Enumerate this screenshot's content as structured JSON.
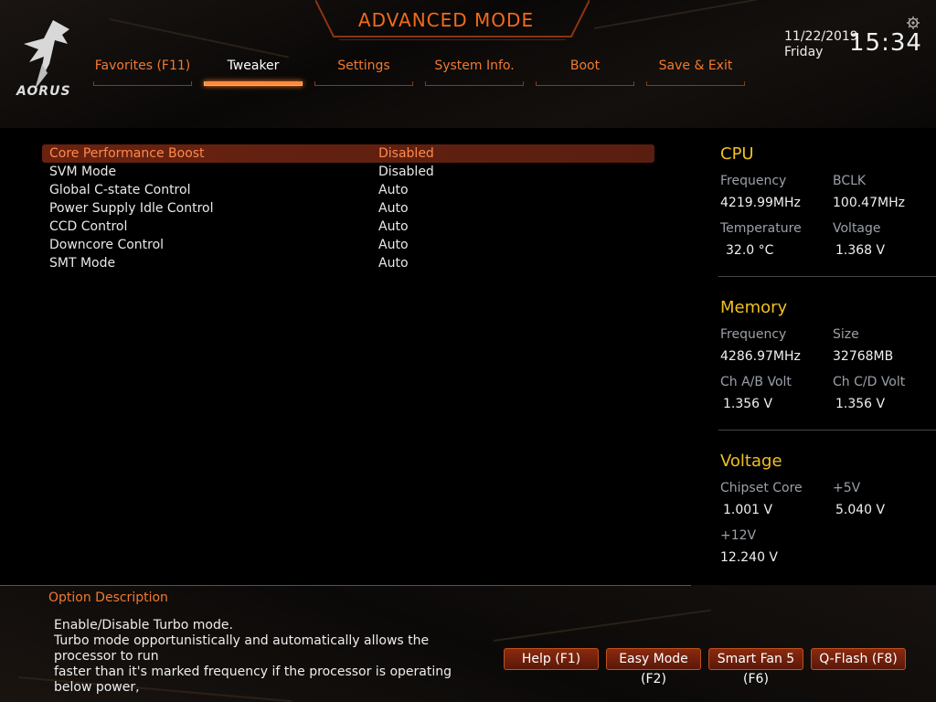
{
  "header": {
    "brand": "AORUS",
    "title": "ADVANCED MODE",
    "date": "11/22/2019",
    "day": "Friday",
    "time": "15:34"
  },
  "tabs": [
    {
      "label": "Favorites (F11)",
      "active": false
    },
    {
      "label": "Tweaker",
      "active": true
    },
    {
      "label": "Settings",
      "active": false
    },
    {
      "label": "System Info.",
      "active": false
    },
    {
      "label": "Boot",
      "active": false
    },
    {
      "label": "Save & Exit",
      "active": false
    }
  ],
  "settings": [
    {
      "label": "Core Performance Boost",
      "value": "Disabled",
      "selected": true
    },
    {
      "label": "SVM Mode",
      "value": "Disabled"
    },
    {
      "label": "Global C-state Control",
      "value": "Auto"
    },
    {
      "label": "Power Supply Idle Control",
      "value": "Auto"
    },
    {
      "label": "CCD Control",
      "value": "Auto"
    },
    {
      "label": "Downcore Control",
      "value": "Auto"
    },
    {
      "label": "SMT Mode",
      "value": "Auto"
    }
  ],
  "cpu": {
    "title": "CPU",
    "freq_label": "Frequency",
    "freq": "4219.99MHz",
    "bclk_label": "BCLK",
    "bclk": "100.47MHz",
    "temp_label": "Temperature",
    "temp": "32.0 °C",
    "volt_label": "Voltage",
    "volt": "1.368 V"
  },
  "memory": {
    "title": "Memory",
    "freq_label": "Frequency",
    "freq": "4286.97MHz",
    "size_label": "Size",
    "size": "32768MB",
    "ab_label": "Ch A/B Volt",
    "ab": "1.356 V",
    "cd_label": "Ch C/D Volt",
    "cd": "1.356 V"
  },
  "voltage": {
    "title": "Voltage",
    "chipset_label": "Chipset Core",
    "chipset": "1.001 V",
    "p5_label": "+5V",
    "p5": "5.040 V",
    "p12_label": "+12V",
    "p12": "12.240 V"
  },
  "description": {
    "title": "Option Description",
    "line1": "Enable/Disable Turbo mode.",
    "line2": "Turbo mode opportunistically and automatically allows the processor to run",
    "line3": "faster than it's marked frequency if the processor is operating below power,"
  },
  "buttons": {
    "help": "Help (F1)",
    "easy": "Easy Mode (F2)",
    "fan": "Smart Fan 5 (F6)",
    "qflash": "Q-Flash (F8)"
  },
  "colors": {
    "accent": "#f26a1b",
    "highlight": "#f0c020"
  }
}
